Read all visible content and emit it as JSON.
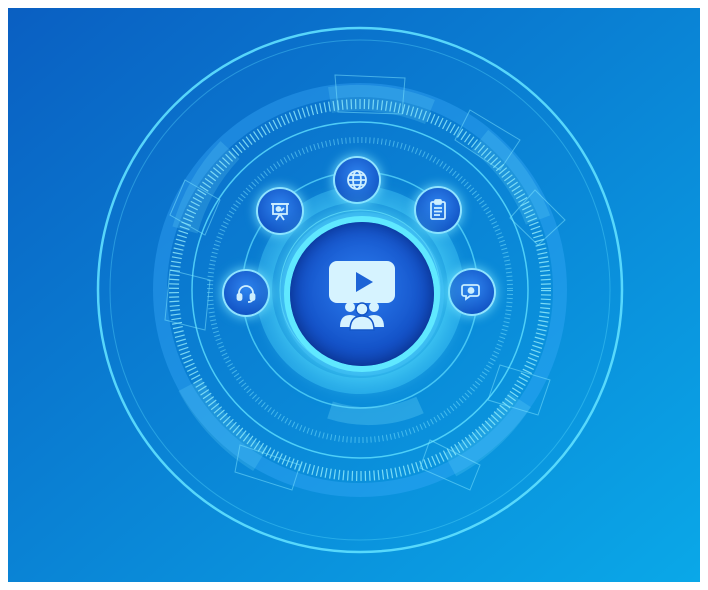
{
  "scene": {
    "background_top": "#0a64c4",
    "background_bottom": "#0aa6e6",
    "ring_color": "#5fe0ff",
    "glow_color": "#7ff0ff"
  },
  "center_hub": {
    "icon": "video-conference-icon"
  },
  "orbit_icons": [
    {
      "icon": "globe-icon"
    },
    {
      "icon": "clipboard-icon"
    },
    {
      "icon": "chat-icon"
    },
    {
      "icon": "headset-icon"
    },
    {
      "icon": "presentation-board-icon"
    }
  ]
}
